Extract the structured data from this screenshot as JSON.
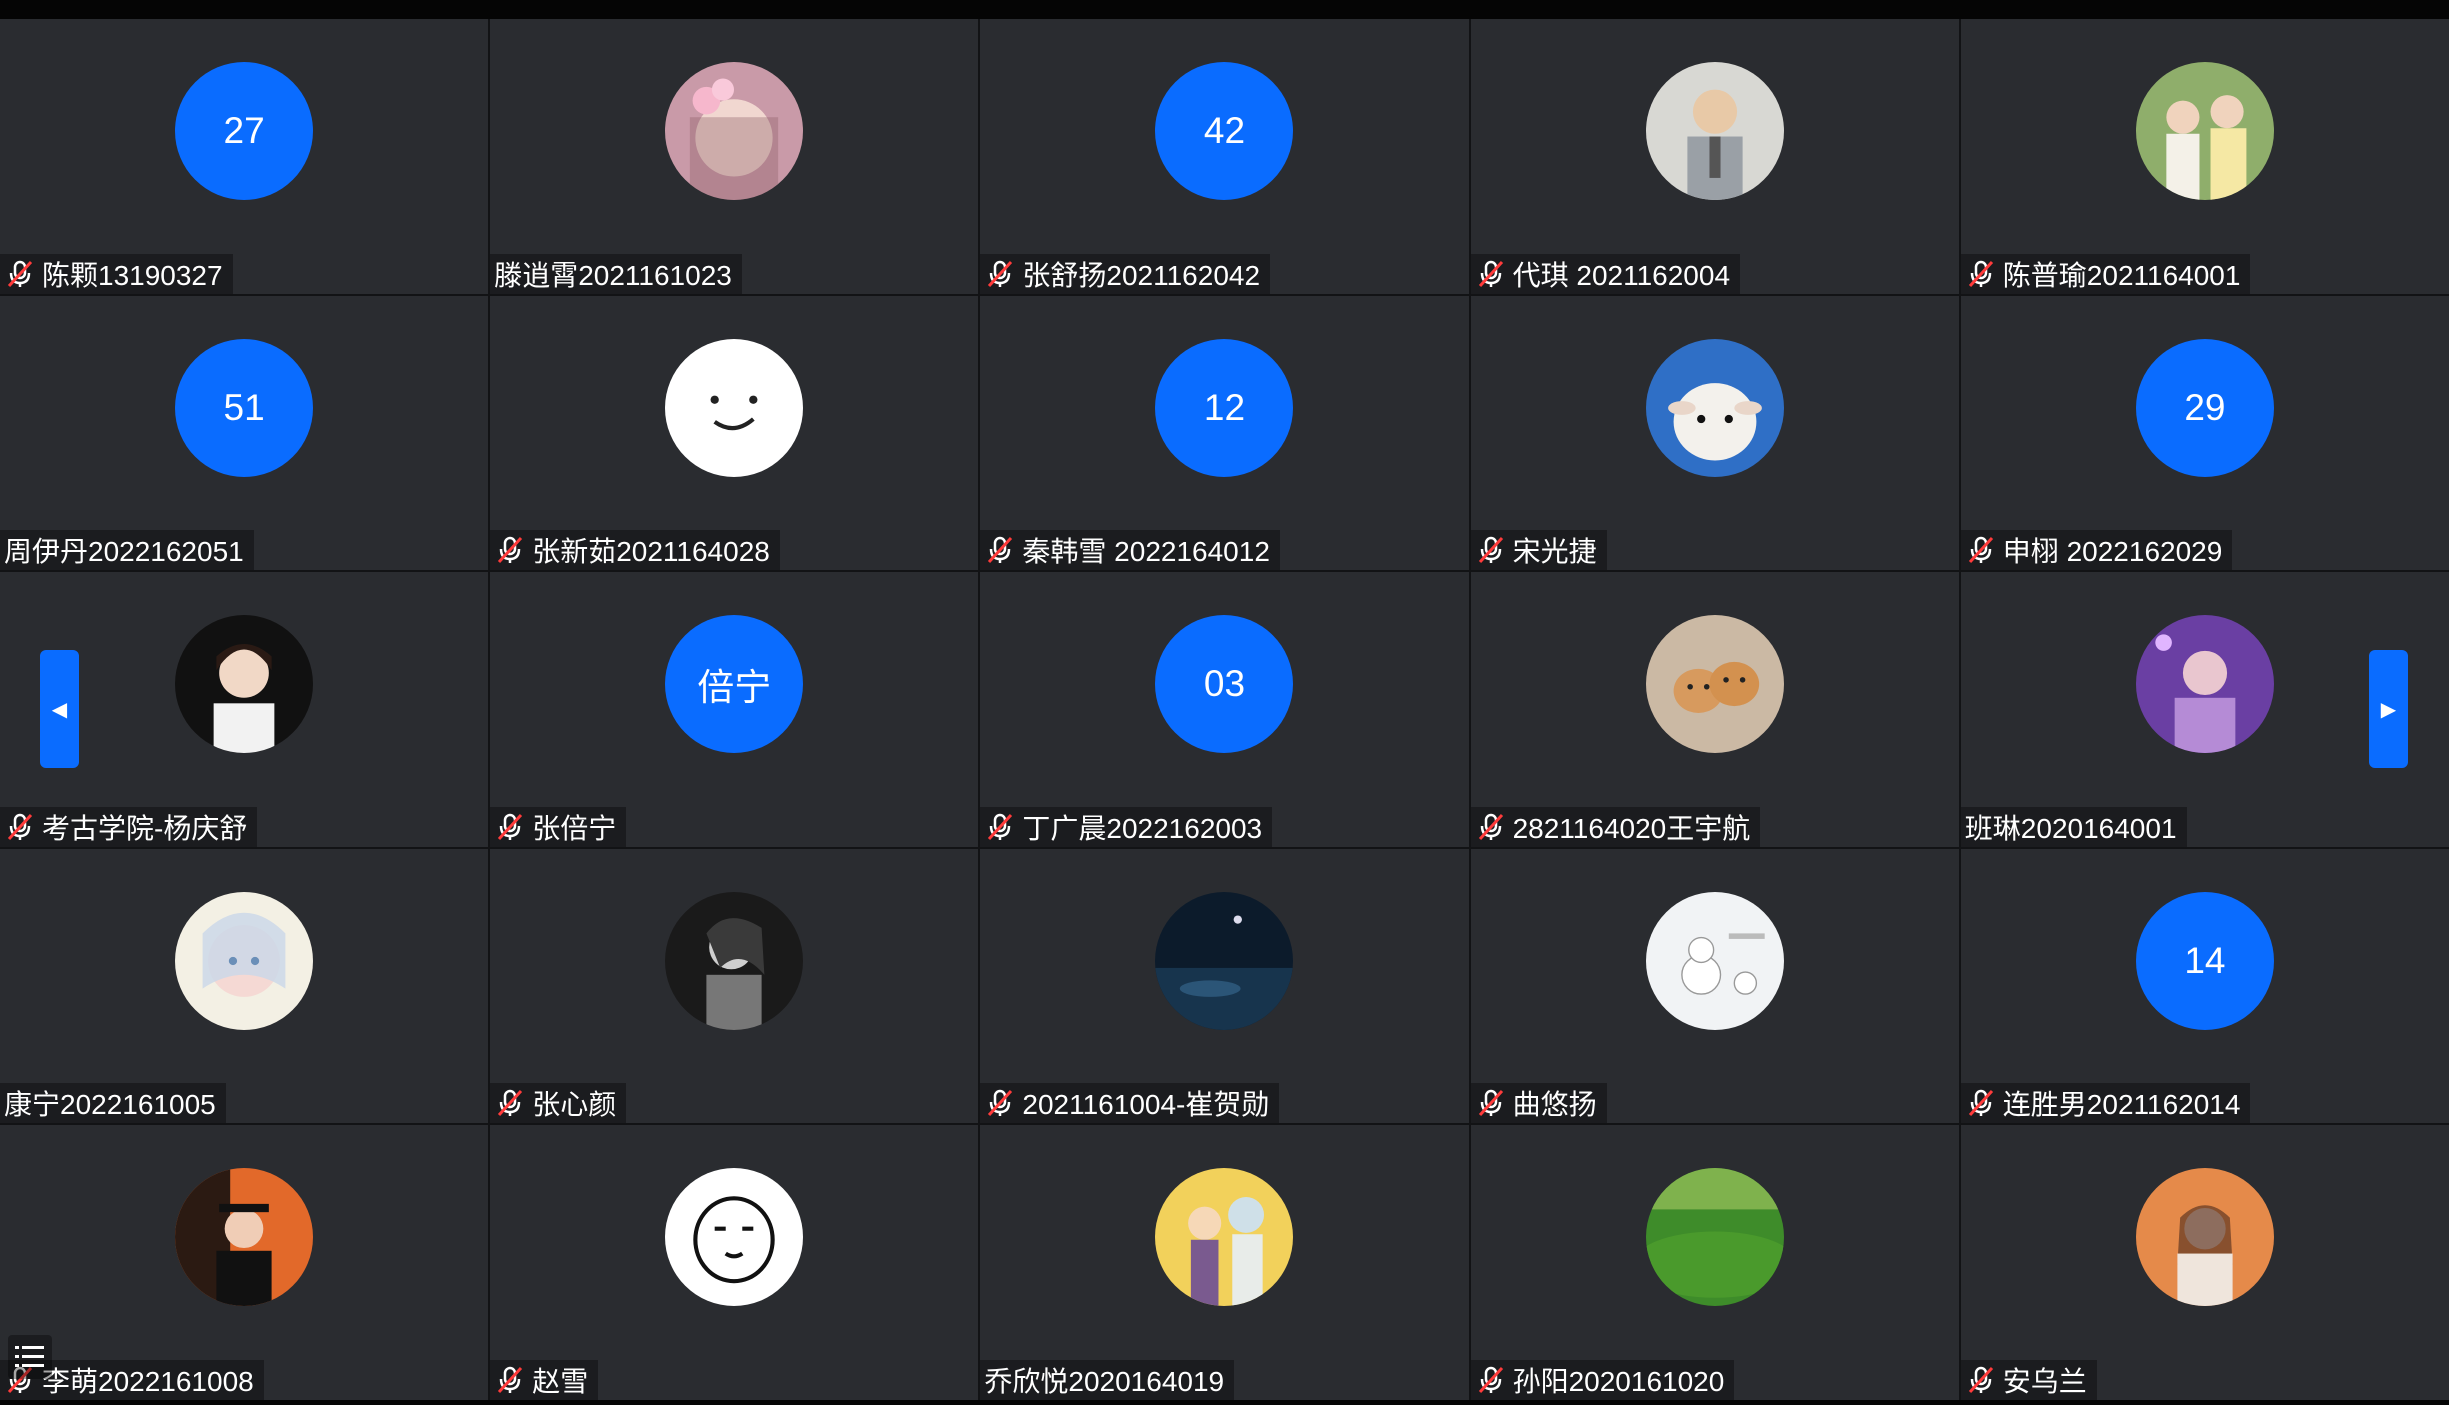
{
  "colors": {
    "accent": "#0a6cff",
    "tile_bg": "#2a2c30",
    "nameplate_bg": "#1b1c1f",
    "mic_muted": "#ff3b3b"
  },
  "participants": [
    {
      "name": "陈颗13190327",
      "avatar_type": "number",
      "avatar_text": "27",
      "muted": true
    },
    {
      "name": "滕逍霄2021161023",
      "avatar_type": "photo",
      "avatar_icon": "girl-flowers-photo-icon",
      "muted": false
    },
    {
      "name": "张舒扬2021162042",
      "avatar_type": "number",
      "avatar_text": "42",
      "muted": true
    },
    {
      "name": "代琪 2021162004",
      "avatar_type": "photo",
      "avatar_icon": "cartoon-man-suit-icon",
      "muted": true
    },
    {
      "name": "陈普瑜2021164001",
      "avatar_type": "photo",
      "avatar_icon": "couple-photo-icon",
      "muted": true
    },
    {
      "name": "周伊丹2022162051",
      "avatar_type": "number",
      "avatar_text": "51",
      "muted": false
    },
    {
      "name": "张新茹2021164028",
      "avatar_type": "photo",
      "avatar_icon": "smiley-face-icon",
      "muted": true
    },
    {
      "name": "秦韩雪 2022164012",
      "avatar_type": "number",
      "avatar_text": "12",
      "muted": true
    },
    {
      "name": "宋光捷",
      "avatar_type": "photo",
      "avatar_icon": "sheep-photo-icon",
      "muted": true
    },
    {
      "name": "申栩 2022162029",
      "avatar_type": "number",
      "avatar_text": "29",
      "muted": true
    },
    {
      "name": "考古学院-杨庆舒",
      "avatar_type": "photo",
      "avatar_icon": "woman-portrait-icon",
      "muted": true
    },
    {
      "name": "张倍宁",
      "avatar_type": "number",
      "avatar_text": "倍宁",
      "muted": true
    },
    {
      "name": "丁广晨2022162003",
      "avatar_type": "number",
      "avatar_text": "03",
      "muted": true
    },
    {
      "name": "2821164020王宇航",
      "avatar_type": "photo",
      "avatar_icon": "cats-photo-icon",
      "muted": true
    },
    {
      "name": "班琳2020164001",
      "avatar_type": "photo",
      "avatar_icon": "girl-purple-photo-icon",
      "muted": false
    },
    {
      "name": "康宁2022161005",
      "avatar_type": "photo",
      "avatar_icon": "anime-girl-icon",
      "muted": false
    },
    {
      "name": "张心颜",
      "avatar_type": "photo",
      "avatar_icon": "woman-bw-photo-icon",
      "muted": true
    },
    {
      "name": "2021161004-崔贺勋",
      "avatar_type": "photo",
      "avatar_icon": "night-scene-icon",
      "muted": true
    },
    {
      "name": "曲悠扬",
      "avatar_type": "photo",
      "avatar_icon": "snowman-cartoon-icon",
      "muted": true
    },
    {
      "name": "连胜男2021162014",
      "avatar_type": "number",
      "avatar_text": "14",
      "muted": true
    },
    {
      "name": "李萌2022161008",
      "avatar_type": "photo",
      "avatar_icon": "graduate-photo-icon",
      "muted": true
    },
    {
      "name": "赵雪",
      "avatar_type": "photo",
      "avatar_icon": "cartoon-face-icon",
      "muted": true
    },
    {
      "name": "乔欣悦2020164019",
      "avatar_type": "photo",
      "avatar_icon": "cartoon-characters-icon",
      "muted": false
    },
    {
      "name": "孙阳2020161020",
      "avatar_type": "photo",
      "avatar_icon": "green-field-icon",
      "muted": true
    },
    {
      "name": "安乌兰",
      "avatar_type": "photo",
      "avatar_icon": "girl-sunset-photo-icon",
      "muted": true
    }
  ],
  "navigation": {
    "prev_icon": "chevron-left-icon",
    "next_icon": "chevron-right-icon"
  },
  "list_toggle_icon": "list-icon"
}
